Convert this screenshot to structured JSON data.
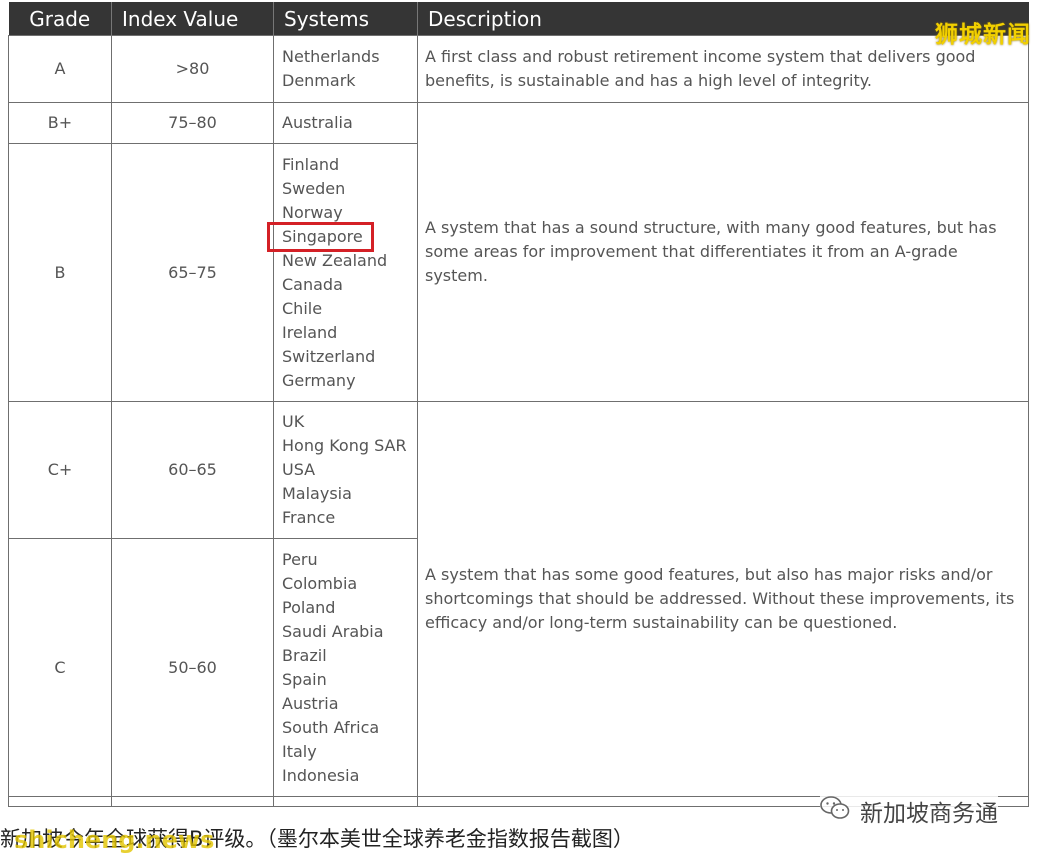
{
  "table": {
    "headers": [
      "Grade",
      "Index Value",
      "Systems",
      "Description"
    ],
    "rows": [
      {
        "grade": "A",
        "index": ">80",
        "systems": [
          "Netherlands",
          "Denmark"
        ],
        "description": "A first class and robust retirement income system that delivers good benefits, is sustainable and has a high level of integrity."
      },
      {
        "grade": "B+",
        "index": "75–80",
        "systems": [
          "Australia"
        ]
      },
      {
        "grade": "B",
        "index": "65–75",
        "systems": [
          "Finland",
          "Sweden",
          "Norway",
          "Singapore",
          "New Zealand",
          "Canada",
          "Chile",
          "Ireland",
          "Switzerland",
          "Germany"
        ],
        "highlighted_system": "Singapore"
      },
      {
        "grade": "C+",
        "index": "60–65",
        "systems": [
          "UK",
          "Hong Kong SAR",
          "USA",
          "Malaysia",
          "France"
        ]
      },
      {
        "grade": "C",
        "index": "50–60",
        "systems": [
          "Peru",
          "Colombia",
          "Poland",
          "Saudi Arabia",
          "Brazil",
          "Spain",
          "Austria",
          "South Africa",
          "Italy",
          "Indonesia"
        ]
      }
    ],
    "description_b": "A system that has a sound structure, with many good features, but has some areas for improvement that differentiates it from an A-grade system.",
    "description_c": "A system that has some good features, but also has major risks and/or shortcomings that should be addressed. Without these improvements, its efficacy and/or long-term sustainability can be questioned."
  },
  "watermark_top": "狮城新闻",
  "watermark_bottom": "shicheng.news",
  "wechat_account": "新加坡商务通",
  "caption": "新加坡今年全球获得B评级。（墨尔本美世全球养老金指数报告截图）",
  "colors": {
    "header_bg": "#353535",
    "highlight_border": "#d42026",
    "watermark": "#f2d000"
  }
}
